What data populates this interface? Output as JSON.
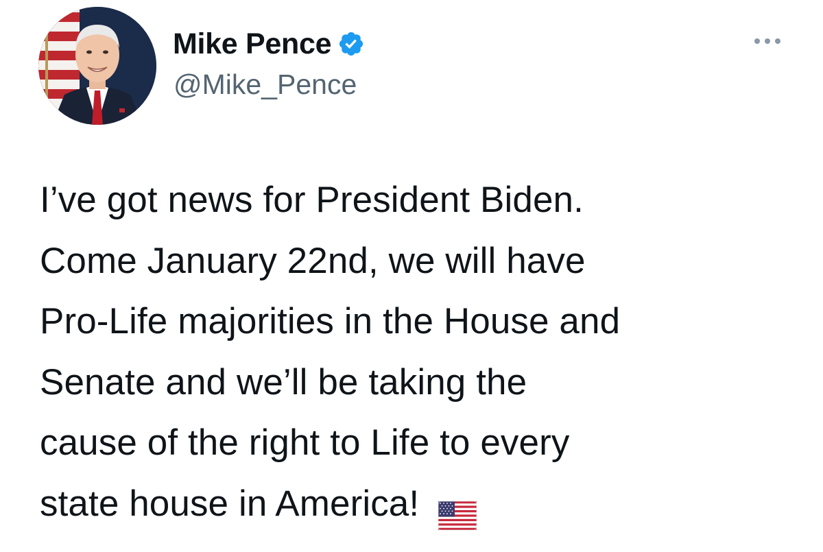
{
  "author": {
    "display_name": "Mike Pence",
    "handle": "@Mike_Pence",
    "verified": true,
    "avatar_icon": "profile-photo"
  },
  "menu": {
    "icon": "more-horizontal-icon"
  },
  "tweet": {
    "lines": [
      "I’ve got news for President Biden.",
      "Come January 22nd, we will have",
      "Pro-Life majorities in the House and",
      "Senate and we’ll be taking the",
      "cause of the right to Life to every",
      "state house in America!"
    ],
    "emoji": "us-flag-emoji"
  },
  "colors": {
    "text": "#0f1419",
    "secondary_text": "#536471",
    "verified_blue": "#1d9bf0",
    "more_icon": "#8b98a5"
  }
}
